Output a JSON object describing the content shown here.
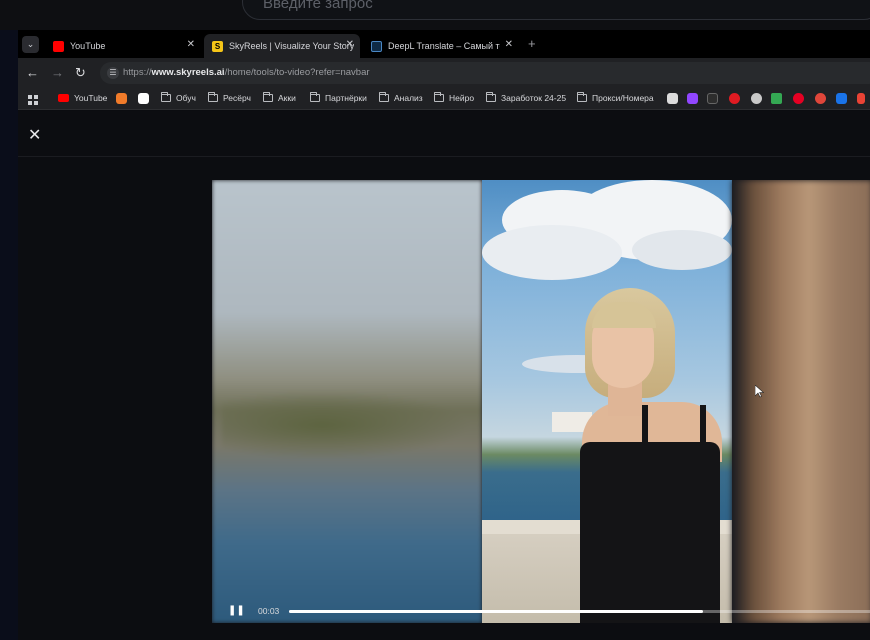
{
  "top_search": {
    "placeholder": "Введите запрос"
  },
  "tabs": [
    {
      "label": "YouTube",
      "favicon_color": "#ff0000",
      "active": false
    },
    {
      "label": "SkyReels | Visualize Your Story",
      "favicon_color": "#f5c518",
      "active": true
    },
    {
      "label": "DeepL Translate – Самый точн...",
      "favicon_color": "#0f2b46",
      "active": false
    }
  ],
  "new_tab_label": "+",
  "address": {
    "scheme": "https://",
    "host": "www.skyreels.ai",
    "path": "/home/tools/to-video?refer=navbar"
  },
  "bookmarks": [
    {
      "label": "YouTube",
      "type": "link",
      "icon": "youtube-icon"
    },
    {
      "label": "Обуч",
      "type": "folder"
    },
    {
      "label": "Ресёрч",
      "type": "folder"
    },
    {
      "label": "Акки",
      "type": "folder"
    },
    {
      "label": "Партнёрки",
      "type": "folder"
    },
    {
      "label": "Анализ",
      "type": "folder"
    },
    {
      "label": "Нейро",
      "type": "folder"
    },
    {
      "label": "Заработок 24-25",
      "type": "folder"
    },
    {
      "label": "Прокси/Номера",
      "type": "folder"
    }
  ],
  "video": {
    "time": "00:03",
    "progress": 0.71
  },
  "colors": {
    "accent": "#f5c518",
    "background": "#0c0d11"
  }
}
